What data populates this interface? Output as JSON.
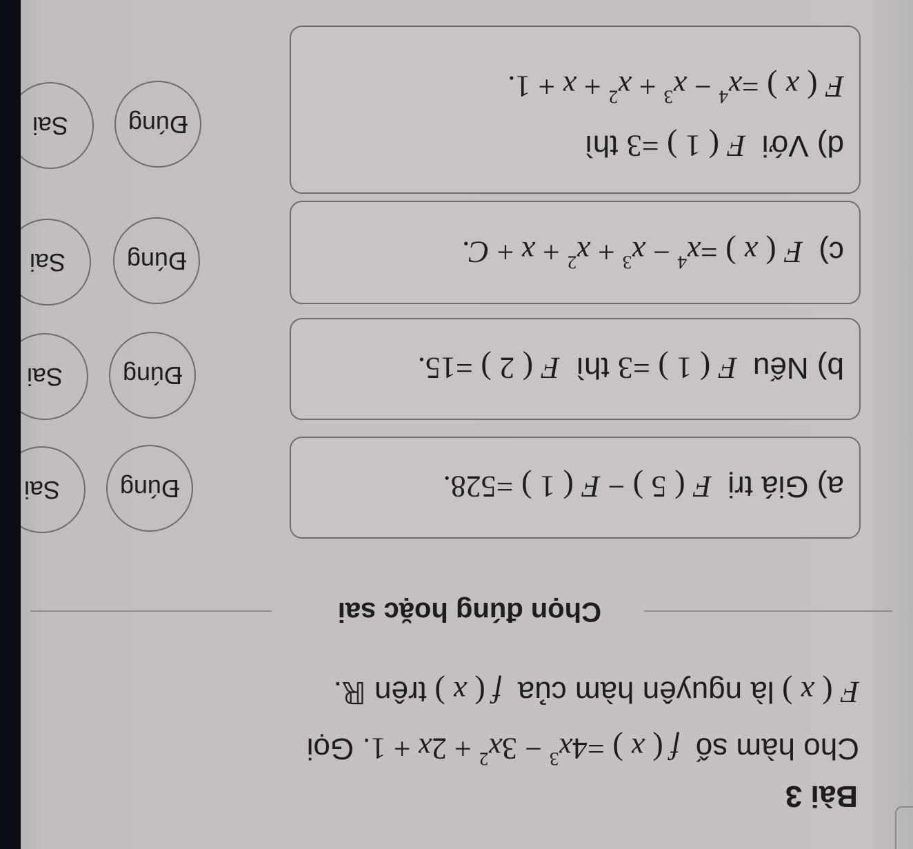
{
  "orientation": "rotated-180",
  "exercise": {
    "title": "Bài 3",
    "intro": {
      "line1_prefix": "Cho hàm số",
      "line1_math": "f ( x ) = 4x³ − 3x² + 2x + 1",
      "line1_suffix": ". Gọi",
      "line2_math_F": "F ( x )",
      "line2_text1": "là nguyên hàm của",
      "line2_math_f": "f ( x )",
      "line2_text2": "trên",
      "line2_set": "ℝ",
      "line2_end": "."
    },
    "section_label": "Chọn đúng hoặc sai"
  },
  "statements": [
    {
      "id": "a",
      "label": "a)",
      "text": "Giá trị",
      "math": "F ( 5 ) − F ( 1 ) = 528.",
      "true_label": "Đúng",
      "false_label": "Sai",
      "selected": null
    },
    {
      "id": "b",
      "label": "b)",
      "text": "Nếu",
      "math_1": "F ( 1 ) = 3",
      "text_2": "thì",
      "math_2": "F ( 2 ) = 15.",
      "true_label": "Đúng",
      "false_label": "Sai",
      "selected": null
    },
    {
      "id": "c",
      "label": "c)",
      "math": "F ( x ) = x⁴ − x³ + x² + x + C.",
      "true_label": "Đúng",
      "false_label": "Sai",
      "selected": null
    },
    {
      "id": "d",
      "label": "d)",
      "text": "Với",
      "math_1": "F ( 1 ) = 3",
      "text_2": "thì",
      "math_2": "F ( x ) = x⁴ − x³ + x² + x + 1.",
      "true_label": "Đúng",
      "false_label": "Sai",
      "selected": null
    }
  ],
  "colors": {
    "background": "#c6c1c3",
    "text": "#1e1c1f",
    "border": "#6f6b6e",
    "bezel": "#0b0d14"
  }
}
